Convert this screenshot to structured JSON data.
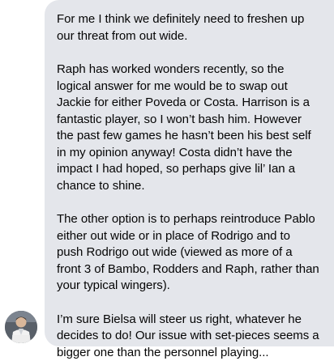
{
  "message": {
    "paragraphs": [
      "For me I think we definitely need to freshen up our threat from out wide.",
      "Raph has worked wonders recently, so the logical answer for me would be to swap out Jackie for either Poveda or Costa. Harrison is a fantastic player, so I won’t bash him. However the past few games he hasn’t been his best self in my opinion anyway! Costa didn’t have the impact I had hoped, so perhaps give lil’ Ian a chance to shine.",
      "The other option is to perhaps reintroduce Pablo either out wide or in place of Rodrigo and to push Rodrigo out wide (viewed as more of a front 3 of Bambo, Rodders and Raph, rather than your typical wingers).",
      "I’m sure Bielsa will steer us right, whatever he decides to do! Our issue with set-pieces seems a bigger one than the personnel playing..."
    ]
  },
  "avatar": {
    "icon": "user-avatar-photo"
  },
  "colors": {
    "bubble_bg": "#e4e6eb",
    "text": "#050505",
    "page_bg": "#ffffff"
  }
}
